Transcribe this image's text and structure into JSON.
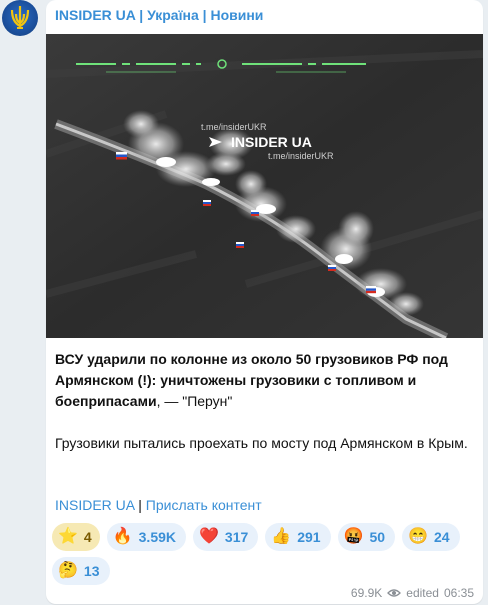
{
  "channel": {
    "name": "INSIDER UA | Україна | Новини"
  },
  "media": {
    "watermark_main": "INSIDER UA",
    "watermark_small_1": "t.me/insiderUKR",
    "watermark_small_2": "t.me/insiderUKR"
  },
  "post": {
    "headline": "ВСУ ударили по колонне из около 50 грузовиков РФ под Армянском (!): уничтожены грузовики с топливом и боеприпасами",
    "headline_suffix": ", — \"Перун\"",
    "body": "Грузовики пытались проехать по мосту под Армянском в Крым."
  },
  "links": {
    "channel_link": "INSIDER UA",
    "separator": "|",
    "submit_link": "Прислать контент"
  },
  "reactions": [
    {
      "icon": "star-icon",
      "emoji": "⭐",
      "count": "4"
    },
    {
      "icon": "fire-icon",
      "emoji": "🔥",
      "count": "3.59K"
    },
    {
      "icon": "heart-icon",
      "emoji": "❤️",
      "count": "317"
    },
    {
      "icon": "thumbs-up-icon",
      "emoji": "👍",
      "count": "291"
    },
    {
      "icon": "angry-face-icon",
      "emoji": "🤬",
      "count": "50"
    },
    {
      "icon": "grinning-face-icon",
      "emoji": "😁",
      "count": "24"
    },
    {
      "icon": "thinking-face-icon",
      "emoji": "🤔",
      "count": "13"
    }
  ],
  "meta": {
    "views": "69.9K",
    "edited": "edited",
    "time": "06:35"
  },
  "colors": {
    "link": "#3a8fd6",
    "bubble": "#ffffff",
    "background": "#e9eef2"
  }
}
